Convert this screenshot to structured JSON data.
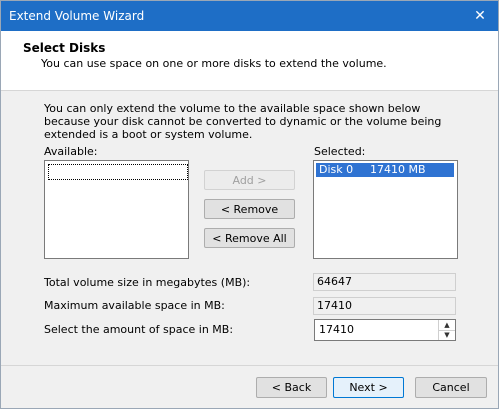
{
  "window": {
    "title": "Extend Volume Wizard",
    "close_glyph": "✕"
  },
  "header": {
    "title": "Select Disks",
    "subtitle": "You can use space on one or more disks to extend the volume."
  },
  "notice": "You can only extend the volume to the available space shown below because your disk cannot be converted to dynamic or the volume being extended is a boot or system volume.",
  "available": {
    "label": "Available:",
    "items": []
  },
  "selected": {
    "label": "Selected:",
    "items": [
      {
        "disk": "Disk 0",
        "size": "17410 MB"
      }
    ]
  },
  "buttons": {
    "add": "Add >",
    "remove": "< Remove",
    "remove_all": "< Remove All",
    "back": "< Back",
    "next": "Next >",
    "cancel": "Cancel"
  },
  "fields": {
    "total_label": "Total volume size in megabytes (MB):",
    "total_value": "64647",
    "max_label": "Maximum available space in MB:",
    "max_value": "17410",
    "amount_label": "Select the amount of space in MB:",
    "amount_value": "17410"
  },
  "icons": {
    "spin_up": "▲",
    "spin_down": "▼"
  }
}
